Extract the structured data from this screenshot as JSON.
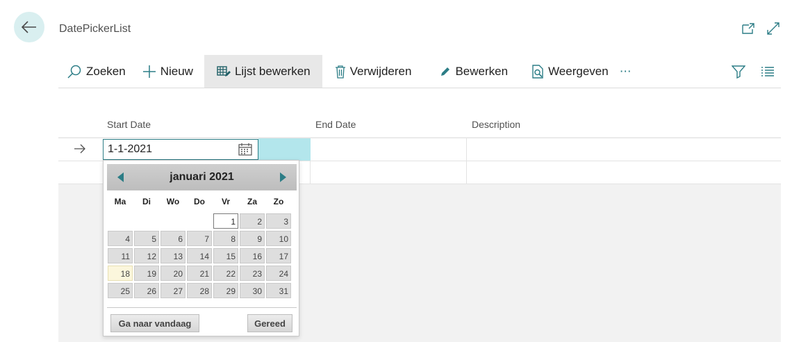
{
  "page": {
    "title": "DatePickerList"
  },
  "toolbar": {
    "search": "Zoeken",
    "new": "Nieuw",
    "edit_list": "Lijst bewerken",
    "delete": "Verwijderen",
    "edit": "Bewerken",
    "view": "Weergeven",
    "more": "⋯"
  },
  "columns": {
    "start_date": "Start Date",
    "end_date": "End Date",
    "description": "Description"
  },
  "row": {
    "start_date_value": "1-1-2021"
  },
  "picker": {
    "month_title": "januari 2021",
    "weekdays": [
      "Ma",
      "Di",
      "Wo",
      "Do",
      "Vr",
      "Za",
      "Zo"
    ],
    "weeks": [
      [
        "",
        "",
        "",
        "",
        "1",
        "2",
        "3"
      ],
      [
        "4",
        "5",
        "6",
        "7",
        "8",
        "9",
        "10"
      ],
      [
        "11",
        "12",
        "13",
        "14",
        "15",
        "16",
        "17"
      ],
      [
        "18",
        "19",
        "20",
        "21",
        "22",
        "23",
        "24"
      ],
      [
        "25",
        "26",
        "27",
        "28",
        "29",
        "30",
        "31"
      ]
    ],
    "selected_day": "1",
    "today_day": "18",
    "today_button": "Ga naar vandaag",
    "done_button": "Gereed"
  },
  "colors": {
    "accent": "#2c7d86",
    "selected_cell": "#b3e6ec",
    "back_circle": "#d9eff0"
  },
  "icons": [
    "back-arrow-icon",
    "open-new-window-icon",
    "expand-icon",
    "search-icon",
    "plus-icon",
    "edit-list-icon",
    "trash-icon",
    "pencil-icon",
    "view-icon",
    "more-icon",
    "filter-icon",
    "list-icon",
    "row-arrow-icon",
    "calendar-icon",
    "chevron-left-icon",
    "chevron-right-icon"
  ]
}
